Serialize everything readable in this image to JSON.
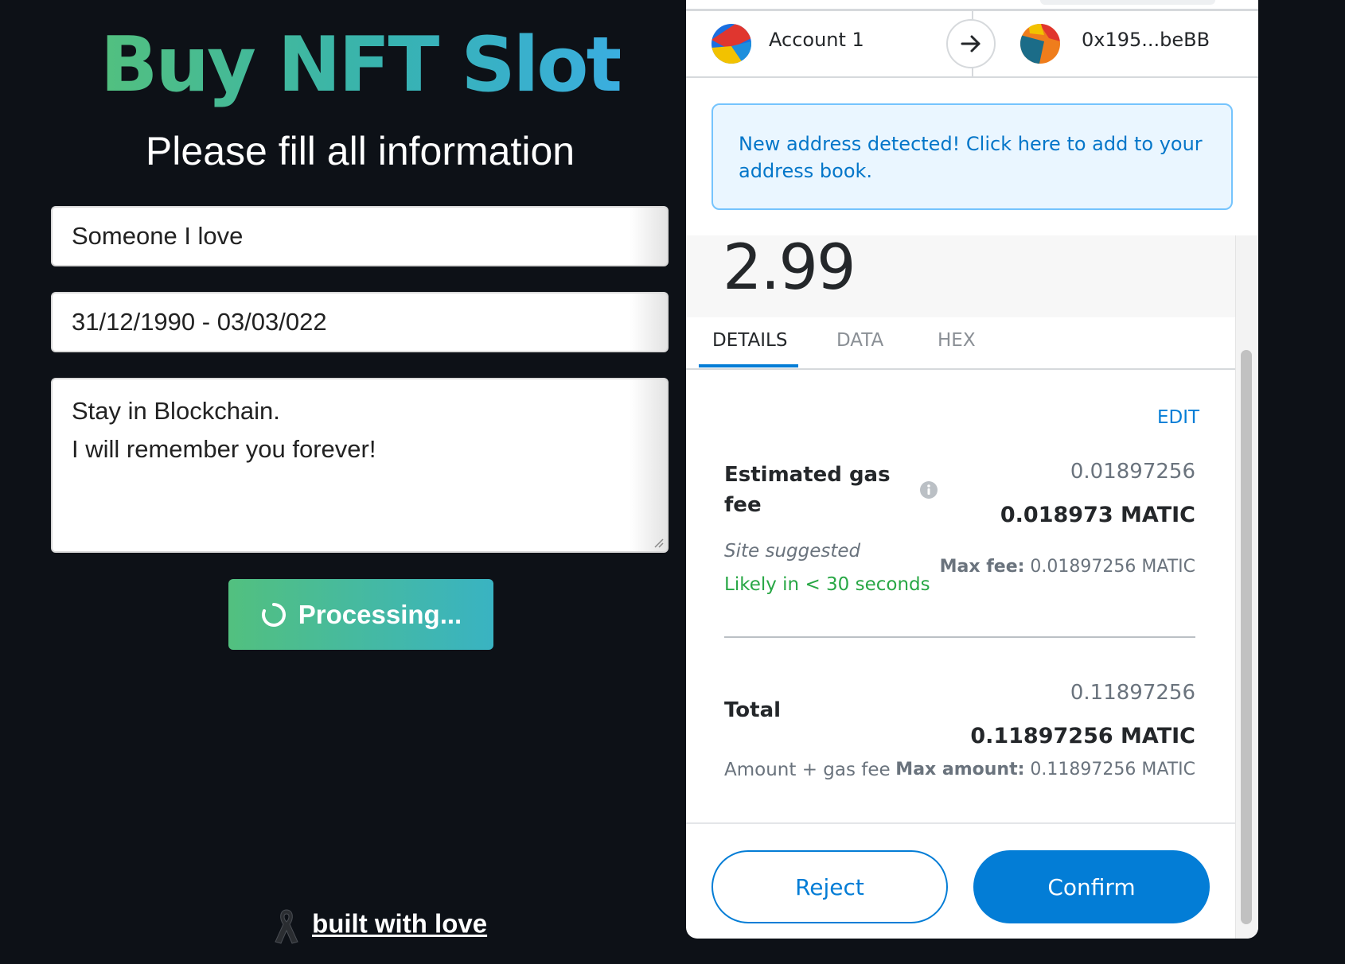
{
  "form": {
    "title": "Buy NFT Slot",
    "subtitle": "Please fill all information",
    "name_value": "Someone I love",
    "dates_value": "31/12/1990 - 03/03/022",
    "message_lines": [
      "Stay in Blockchain.",
      "I will remember you forever!"
    ],
    "process_label": "Processing...",
    "footer_link": "built with love"
  },
  "wallet": {
    "from_account": "Account 1",
    "to_address": "0x195...beBB",
    "notice": "New address detected! Click here to add to your address book.",
    "amount": "2.99",
    "tabs": [
      "DETAILS",
      "DATA",
      "HEX"
    ],
    "active_tab": "DETAILS",
    "edit_label": "EDIT",
    "gas": {
      "label": "Estimated gas fee",
      "fiat": "0.01897256",
      "matic": "0.018973 MATIC",
      "site_suggested": "Site suggested",
      "likely": "Likely in < 30 seconds",
      "max_fee_label": "Max fee:",
      "max_fee_value": "0.01897256 MATIC"
    },
    "total": {
      "label": "Total",
      "fiat": "0.11897256",
      "matic": "0.11897256 MATIC",
      "sub_label": "Amount + gas fee",
      "max_amount_label": "Max amount:",
      "max_amount_value": "0.11897256 MATIC"
    },
    "reject_label": "Reject",
    "confirm_label": "Confirm"
  },
  "colors": {
    "page_background": "#0d1117",
    "title_gradient_start": "#52c07f",
    "title_gradient_end": "#3aaee0",
    "metamask_blue": "#037dd6",
    "success_green": "#28a745"
  },
  "icons": {
    "spinner": "spinner-icon",
    "ribbon": "ribbon-icon",
    "arrow": "arrow-right-icon",
    "info": "info-icon"
  }
}
